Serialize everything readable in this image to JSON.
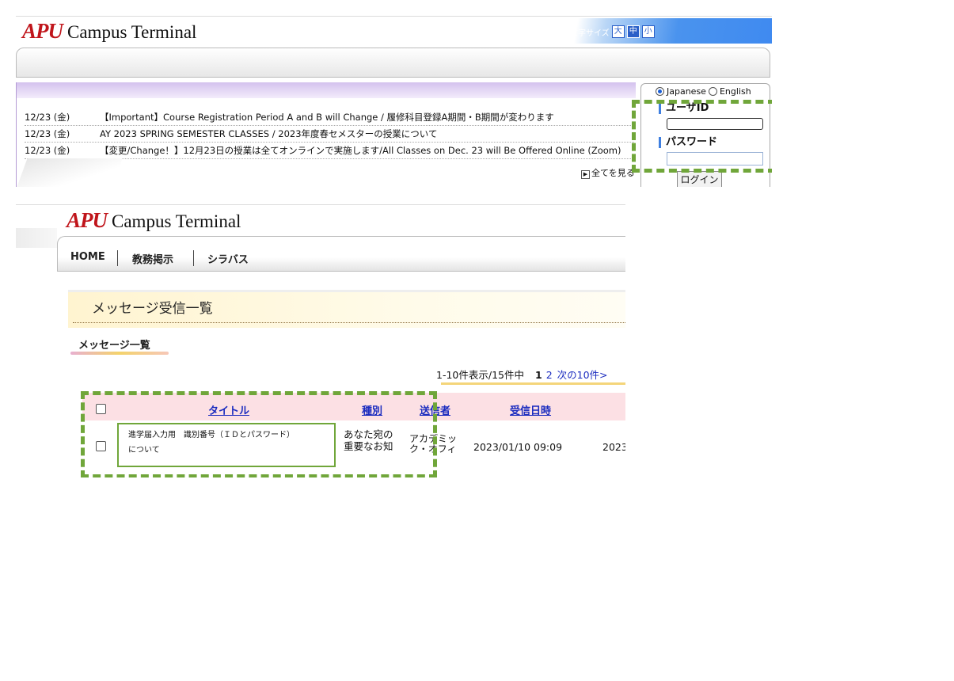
{
  "top": {
    "logo_mark": "APU",
    "logo_text": "Campus Terminal",
    "font_size": {
      "label": "文字サイズ",
      "large": "大",
      "medium": "中",
      "small": "小"
    },
    "notices": [
      {
        "date": "12/23 (金)",
        "text": "【Important】Course Registration Period A and B will Change / 履修科目登録A期間・B期間が変わります"
      },
      {
        "date": "12/23 (金)",
        "text": "AY 2023 SPRING SEMESTER CLASSES / 2023年度春セメスターの授業について"
      },
      {
        "date": "12/23 (金)",
        "text": "【変更/Change！】12月23日の授業は全てオンラインで実施します/All Classes on Dec. 23 will Be Offered Online (Zoom)"
      }
    ],
    "see_all": "全てを見る",
    "login": {
      "lang_japanese": "Japanese",
      "lang_english": "English",
      "user_id_label": "ユーザID",
      "user_id_value": "",
      "password_label": "パスワード",
      "password_value": "",
      "login_button": "ログイン"
    }
  },
  "bottom": {
    "logo_mark": "APU",
    "logo_text": "Campus Terminal",
    "nav": {
      "home": "HOME",
      "notice": "教務掲示",
      "syllabus": "シラバス"
    },
    "page_title": "メッセージ受信一覧",
    "section_title": "メッセージ一覧",
    "pager": {
      "summary": "1-10件表示/15件中",
      "current": "1",
      "page2": "2",
      "next": "次の10件>"
    },
    "table": {
      "headers": {
        "title": "タイトル",
        "type": "種別",
        "sender": "送信者",
        "received": "受信日時"
      },
      "rows": [
        {
          "title_line1": "進学届入力用　識別番号（ＩＤとパスワード）",
          "title_line2": "について",
          "type_line1": "あなた宛の",
          "type_line2": "重要なお知",
          "sender_line1": "アカデミッ",
          "sender_line2": "ク・オフィ",
          "received": "2023/01/10 09:09",
          "extra": "2023"
        }
      ]
    }
  }
}
